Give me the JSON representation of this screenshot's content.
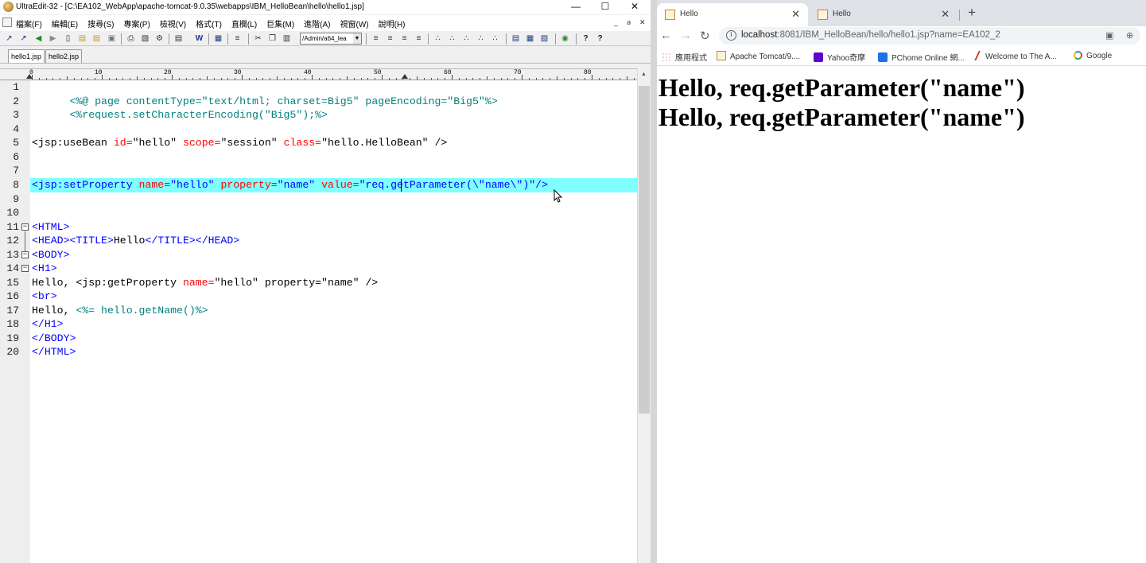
{
  "editor": {
    "title": "UltraEdit-32 - [C:\\EA102_WebApp\\apache-tomcat-9.0.35\\webapps\\IBM_HelloBean\\hello\\hello1.jsp]",
    "window_buttons": {
      "minimize": "—",
      "maximize": "☐",
      "close": "✕"
    },
    "mdi_buttons": [
      "_",
      "ə",
      "✕"
    ],
    "menu": [
      "檔案(F)",
      "編輯(E)",
      "搜尋(S)",
      "專案(P)",
      "檢視(V)",
      "格式(T)",
      "直欄(L)",
      "巨集(M)",
      "進階(A)",
      "視窗(W)",
      "說明(H)"
    ],
    "toolbar_combo": "/Admin/a64_lea",
    "file_tabs": [
      "hello1.jsp",
      "hello2.jsp"
    ],
    "ruler_labels": [
      "0",
      "10",
      "20",
      "30",
      "40",
      "50",
      "60",
      "70",
      "80"
    ],
    "line_numbers": [
      "1",
      "2",
      "3",
      "4",
      "5",
      "6",
      "7",
      "8",
      "9",
      "10",
      "11",
      "12",
      "13",
      "14",
      "15",
      "16",
      "17",
      "18",
      "19",
      "20"
    ],
    "code": {
      "l1": {
        "a": "<%@ page contentType=\"text/html; charset=Big5\" pageEncoding=\"Big5\"%>"
      },
      "l2": {
        "a": "<%request.setCharacterEncoding(\"Big5\");%>"
      },
      "l5": {
        "a": "<jsp:useBean ",
        "b": "id=",
        "c": "\"hello\" ",
        "d": "scope=",
        "e": "\"session\" ",
        "f": "class=",
        "g": "\"hello.HelloBean\" />"
      },
      "l8": {
        "a": "<jsp:setProperty ",
        "b": "name=",
        "c": "\"hello\" ",
        "d": "property=",
        "e": "\"name\" ",
        "f": "value=",
        "g": "\"",
        "h": "req.getParameter(\\\"name\\\")",
        "i": "\"/>"
      },
      "l11": {
        "a": "<HTML>"
      },
      "l12": {
        "a": "<HEAD><TITLE>",
        "b": "Hello",
        "c": "</TITLE></HEAD>"
      },
      "l13": {
        "a": "<BODY>"
      },
      "l14": {
        "a": "<H1>"
      },
      "l15": {
        "a": "Hello, <jsp:getProperty ",
        "b": "name=",
        "c": "\"hello\" property=\"name\" />"
      },
      "l16": {
        "a": "<br>"
      },
      "l17": {
        "a": "Hello, ",
        "b": "<%= hello.getName()%>"
      },
      "l18": {
        "a": "</H1>"
      },
      "l19": {
        "a": "</BODY>"
      },
      "l20": {
        "a": "</HTML>"
      }
    }
  },
  "browser": {
    "tabs": [
      {
        "title": "Hello",
        "close": "✕"
      },
      {
        "title": "Hello",
        "close": "✕"
      }
    ],
    "new_tab": "+",
    "nav": {
      "back": "←",
      "forward": "→",
      "reload": "↻"
    },
    "url_host": "localhost",
    "url_path": ":8081/IBM_HelloBean/hello/hello1.jsp?name=EA102_2",
    "bookmarks": [
      "應用程式",
      "Apache Tomcat/9....",
      "Yahoo奇摩",
      "PChome Online 網...",
      "Welcome to The A...",
      "Google"
    ],
    "content_lines": [
      "Hello, req.getParameter(\"name\")",
      "Hello, req.getParameter(\"name\")"
    ]
  },
  "colors": {
    "highlight_line": "#80ffff",
    "jsp_teal": "#00807e",
    "attr_red": "#ff0000",
    "tag_blue": "#0000ff"
  }
}
